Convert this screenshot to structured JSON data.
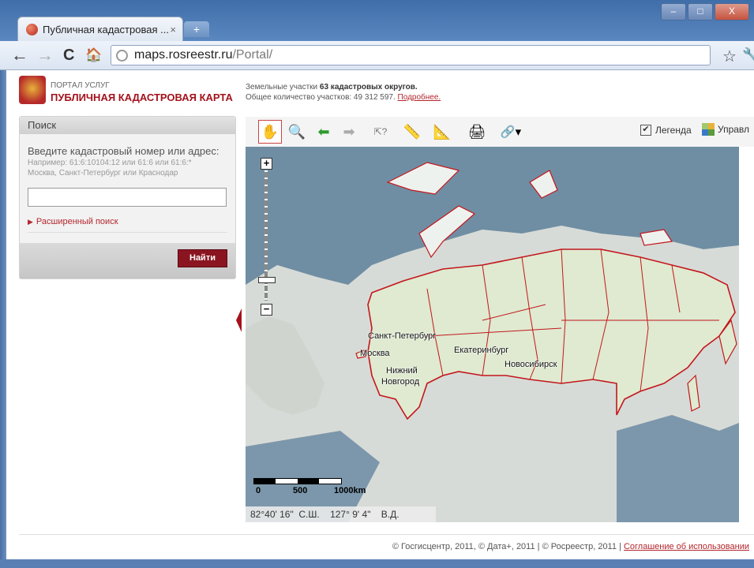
{
  "browser": {
    "tab_title": "Публичная кадастровая ...",
    "tab_close": "×",
    "new_tab": "+",
    "url_host": "maps.rosreestr.ru",
    "url_path": "/Portal/",
    "win_min": "–",
    "win_max": "□",
    "win_close": "X",
    "back": "←",
    "forward": "→",
    "reload": "C",
    "home": "🏠",
    "star": "☆",
    "wrench": "🔧"
  },
  "header": {
    "portal_small": "ПОРТАЛ УСЛУГ",
    "portal_title": "ПУБЛИЧНАЯ КАДАСТРОВАЯ КАРТА",
    "info_prefix": "Земельные участки ",
    "info_bold": "63 кадастровых округов.",
    "info_count": "Общее количество участков: 49 312 597. ",
    "info_link": "Подробнее."
  },
  "search": {
    "header": "Поиск",
    "hint": "Введите кадастровый номер или адрес:",
    "example1": "Например: 61:6:10104:12 или 61:6 или 61:6:*",
    "example2": "Москва, Санкт-Петербург или Краснодар",
    "value": "",
    "advanced": "Расширенный поиск",
    "find": "Найти"
  },
  "map_toolbar": {
    "pan_icon": "✋",
    "zoom_icon": "🔍",
    "back_icon": "⬅",
    "forward_icon": "➡",
    "identify_icon": "⇱?",
    "measure_len_icon": "📏",
    "measure_area_icon": "📐",
    "print_icon": "🖨",
    "link_icon": "🔗▾",
    "legend_check": "✔",
    "legend": "Легенда",
    "manage": "Управл"
  },
  "map": {
    "zoom_in": "+",
    "zoom_out": "−",
    "cities": [
      "Санкт-Петербург",
      "Москва",
      "Нижний",
      "Новгород",
      "Екатеринбург",
      "Новосибирск"
    ],
    "scale": [
      "0",
      "500",
      "1000km"
    ],
    "coords": "82°40' 16\"  С.Ш.    127° 9' 4\"    В.Д."
  },
  "footer": {
    "text": "© Госгисцентр, 2011, © Дата+, 2011 | © Росреестр, 2011 | ",
    "link": "Соглашение об использовании"
  }
}
